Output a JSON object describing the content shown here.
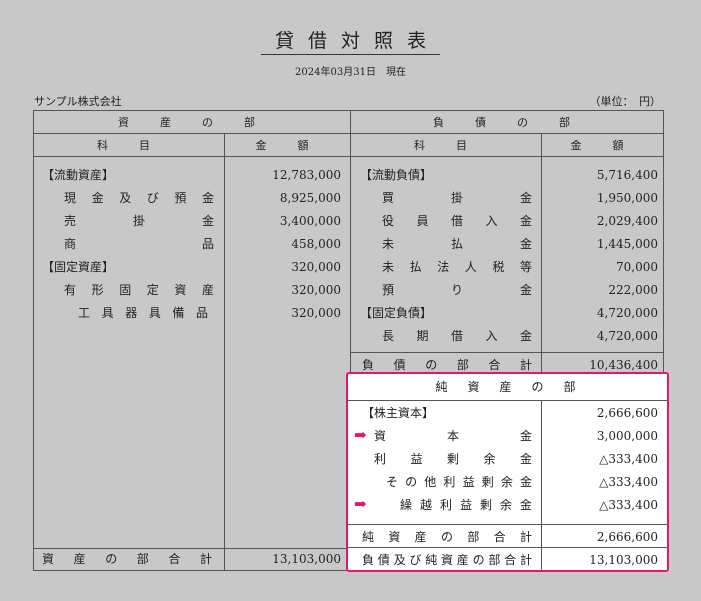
{
  "title": "貸借対照表",
  "date": "2024年03月31日　現在",
  "company": "サンプル株式会社",
  "unit": "（単位：　円）",
  "headers": {
    "assets_section": "資　産　の　部",
    "liabilities_section": "負　債　の　部",
    "account": "科　目",
    "amount": "金　額"
  },
  "assets": [
    {
      "label": "【流動資産】",
      "amount": "12,783,000",
      "type": "group"
    },
    {
      "label": "現金及び預金",
      "amount": "8,925,000",
      "type": "item"
    },
    {
      "label": "売掛金",
      "amount": "3,400,000",
      "type": "item"
    },
    {
      "label": "商品",
      "amount": "458,000",
      "type": "item"
    },
    {
      "label": "【固定資産】",
      "amount": "320,000",
      "type": "group"
    },
    {
      "label": "有形固定資産",
      "amount": "320,000",
      "type": "item"
    },
    {
      "label": "工具器具備品",
      "amount": "320,000",
      "type": "sub"
    }
  ],
  "liabilities": [
    {
      "label": "【流動負債】",
      "amount": "5,716,400",
      "type": "group"
    },
    {
      "label": "買掛金",
      "amount": "1,950,000",
      "type": "item"
    },
    {
      "label": "役員借入金",
      "amount": "2,029,400",
      "type": "item"
    },
    {
      "label": "未払金",
      "amount": "1,445,000",
      "type": "item"
    },
    {
      "label": "未払法人税等",
      "amount": "70,000",
      "type": "item"
    },
    {
      "label": "預り金",
      "amount": "222,000",
      "type": "item"
    },
    {
      "label": "【固定負債】",
      "amount": "4,720,000",
      "type": "group"
    },
    {
      "label": "長期借入金",
      "amount": "4,720,000",
      "type": "item"
    }
  ],
  "liabilities_total": {
    "label": "負債の部合計",
    "amount": "10,436,400"
  },
  "net_assets": {
    "header": "純　資　産　の　部",
    "rows": [
      {
        "label": "【株主資本】",
        "amount": "2,666,600",
        "type": "group",
        "arrow": false
      },
      {
        "label": "資本金",
        "amount": "3,000,000",
        "type": "item0",
        "arrow": true
      },
      {
        "label": "利益剰余金",
        "amount": "△333,400",
        "type": "item",
        "arrow": false
      },
      {
        "label": "その他利益剰余金",
        "amount": "△333,400",
        "type": "sub",
        "arrow": false
      },
      {
        "label": "繰越利益剰余金",
        "amount": "△333,400",
        "type": "sub2",
        "arrow": true
      }
    ],
    "total": {
      "label": "純資産の部合計",
      "amount": "2,666,600"
    },
    "grand_total": {
      "label": "負債及び純資産の部合計",
      "amount": "13,103,000"
    }
  },
  "assets_total": {
    "label": "資産の部合計",
    "amount": "13,103,000"
  },
  "colors": {
    "highlight": "#e0186f"
  }
}
